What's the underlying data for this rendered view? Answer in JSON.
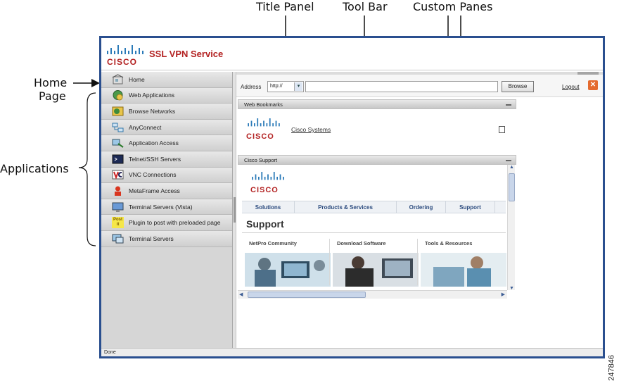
{
  "annotations": {
    "title_panel": "Title Panel",
    "tool_bar": "Tool Bar",
    "custom_panes": "Custom Panes",
    "home_page": [
      "Home",
      "Page"
    ],
    "applications": "Applications",
    "figure_id": "247846"
  },
  "title_panel": {
    "logo_word": "CISCO",
    "service_title": "SSL VPN Service"
  },
  "sidebar": {
    "items": [
      {
        "label": "Home",
        "icon": "home-icon"
      },
      {
        "label": "Web Applications",
        "icon": "web-applications-icon"
      },
      {
        "label": "Browse Networks",
        "icon": "browse-networks-icon"
      },
      {
        "label": "AnyConnect",
        "icon": "anyconnect-icon"
      },
      {
        "label": "Application Access",
        "icon": "application-access-icon"
      },
      {
        "label": "Telnet/SSH Servers",
        "icon": "terminal-icon"
      },
      {
        "label": "VNC Connections",
        "icon": "vnc-icon"
      },
      {
        "label": "MetaFrame Access",
        "icon": "metaframe-icon"
      },
      {
        "label": "Terminal Servers (Vista)",
        "icon": "terminal-servers-vista-icon"
      },
      {
        "label": "Plugin to post with preloaded page",
        "icon": "post-it-icon",
        "icon_text": "Post it"
      },
      {
        "label": "Terminal Servers",
        "icon": "terminal-servers-icon"
      }
    ]
  },
  "toolbar": {
    "address_label": "Address",
    "protocol": "http://",
    "url_value": "",
    "browse_label": "Browse",
    "logout_label": "Logout"
  },
  "web_bookmarks": {
    "title": "Web Bookmarks",
    "logo_word": "CISCO",
    "link_label": "Cisco Systems"
  },
  "cisco_support": {
    "title": "Cisco Support",
    "logo_word": "CISCO",
    "tabs": [
      "Solutions",
      "Products & Services",
      "Ordering",
      "Support"
    ],
    "heading": "Support",
    "columns": [
      "NetPro Community",
      "Download Software",
      "Tools & Resources"
    ]
  },
  "status_bar": {
    "text": "Done"
  },
  "colors": {
    "brand_red": "#b32222",
    "window_border": "#2a4f8f",
    "logout_icon": "#e46a2e",
    "tab_text": "#2d4c7f"
  }
}
